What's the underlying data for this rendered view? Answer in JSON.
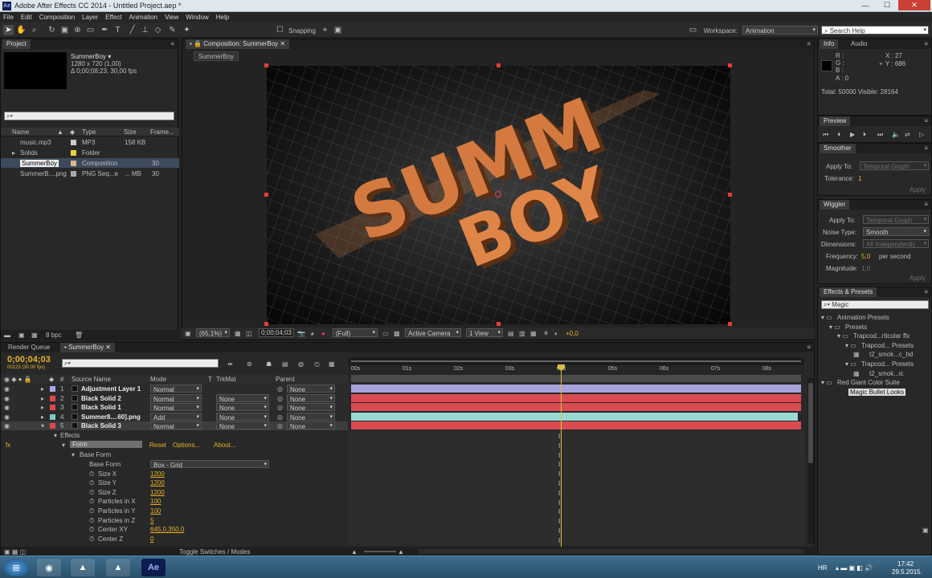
{
  "app": {
    "title": "Adobe After Effects CC 2014 - Untitled Project.aep *",
    "icon": "Ae"
  },
  "menu": [
    "File",
    "Edit",
    "Composition",
    "Layer",
    "Effect",
    "Animation",
    "View",
    "Window",
    "Help"
  ],
  "toolbar": {
    "snapping": "Snapping",
    "workspace_label": "Workspace:",
    "workspace": "Animation",
    "search_placeholder": "Search Help"
  },
  "project": {
    "tab": "Project",
    "comp_name": "SummerBoy ▾",
    "comp_dims": "1280 x 720 (1,00)",
    "comp_dur": "Δ 0;00;08;23, 30,00 fps",
    "search_placeholder": "",
    "columns": [
      "Name",
      "Type",
      "Size",
      "Frame..."
    ],
    "items": [
      {
        "name": "music.mp3",
        "type": "MP3",
        "size": "158 KB",
        "frame": "",
        "color": "#c9c9c9"
      },
      {
        "name": "Solids",
        "type": "Folder",
        "size": "",
        "frame": "",
        "color": "#e8d03a"
      },
      {
        "name": "SummerBoy",
        "type": "Composition",
        "size": "",
        "frame": "30",
        "color": "#d9b78a"
      },
      {
        "name": "SummerB....png",
        "type": "PNG Seq...e",
        "size": "... MB",
        "frame": "30",
        "color": "#a8a8a8"
      }
    ],
    "bpc": "8 bpc"
  },
  "composition": {
    "tab": "Composition: SummerBoy",
    "subtab": "SummerBoy",
    "zoom": "(65,1%)",
    "timecode": "0;00;04;03",
    "resolution": "(Full)",
    "camera": "Active Camera",
    "view": "1 View",
    "exposure": "+0,0",
    "artwork": [
      "SUMM",
      "BOY"
    ]
  },
  "info": {
    "tabs": [
      "Info",
      "Audio"
    ],
    "r": "R :",
    "g": "G :",
    "b": "B :",
    "a": "A : 0",
    "x": "X : 27",
    "y": "Y : 686",
    "total": "Total: 50000  Visible: 28164"
  },
  "preview": {
    "tab": "Preview"
  },
  "smoother": {
    "tab": "Smoother",
    "apply_to_label": "Apply To:",
    "apply_to": "Temporal Graph",
    "tolerance_label": "Tolerance:",
    "tolerance": "1",
    "apply": "Apply"
  },
  "wiggler": {
    "tab": "Wiggler",
    "apply_to_label": "Apply To:",
    "apply_to": "Temporal Graph",
    "noise_label": "Noise Type:",
    "noise": "Smooth",
    "dimensions_label": "Dimensions:",
    "dimensions": "All Independently",
    "frequency_label": "Frequency:",
    "frequency": "5,0",
    "frequency_unit": "per second",
    "magnitude_label": "Magnitude:",
    "magnitude": "1,0",
    "apply": "Apply"
  },
  "effects_presets": {
    "tab": "Effects & Presets",
    "search": "Magic",
    "tree": [
      {
        "label": "Animation Presets",
        "indent": 0,
        "type": "folder"
      },
      {
        "label": "Presets",
        "indent": 1,
        "type": "folder"
      },
      {
        "label": "Trapcod...rticular ffx",
        "indent": 2,
        "type": "folder"
      },
      {
        "label": "Trapcod... Presets",
        "indent": 3,
        "type": "folder"
      },
      {
        "label": "t2_smok...c_hd",
        "indent": 4,
        "type": "file"
      },
      {
        "label": "Trapcod... Presets",
        "indent": 3,
        "type": "folder"
      },
      {
        "label": "t2_smok...ic",
        "indent": 4,
        "type": "file"
      },
      {
        "label": "Red Giant Color Suite",
        "indent": 0,
        "type": "folder"
      },
      {
        "label": "Magic Bullet Looks",
        "indent": 1,
        "type": "fx"
      }
    ]
  },
  "timeline": {
    "tabs": [
      "Render Queue",
      "SummerBoy"
    ],
    "timecode": "0;00;04;03",
    "frames": "00123 (30.00 fps)",
    "headers": {
      "num": "#",
      "source": "Source Name",
      "mode": "Mode",
      "t": "T",
      "trkmat": "TrkMat",
      "parent": "Parent"
    },
    "layers": [
      {
        "num": "1",
        "name": "Adjustment Layer 1",
        "mode": "Normal",
        "trkmat": "",
        "parent": "None",
        "color": "#a9a9e8",
        "bar": "#a8a2da"
      },
      {
        "num": "2",
        "name": "Black Solid 2",
        "mode": "Normal",
        "trkmat": "None",
        "parent": "None",
        "color": "#e0484e",
        "bar": "#d94c52"
      },
      {
        "num": "3",
        "name": "Black Solid 1",
        "mode": "Normal",
        "trkmat": "None",
        "parent": "None",
        "color": "#e0484e",
        "bar": "#d94c52"
      },
      {
        "num": "4",
        "name": "Summer8....60].png",
        "mode": "Add",
        "trkmat": "None",
        "parent": "None",
        "color": "#7ec9c9",
        "bar": "#9ad8d2"
      },
      {
        "num": "5",
        "name": "Black Solid 3",
        "mode": "Normal",
        "trkmat": "None",
        "parent": "None",
        "color": "#e0484e",
        "bar": "#d94c52"
      }
    ],
    "effects_label": "Effects",
    "form": {
      "name": "Form",
      "reset": "Reset",
      "options": "Options...",
      "about": "About..."
    },
    "base_form_group": "Base Form",
    "properties": [
      {
        "name": "Base Form",
        "value": "Box - Grid",
        "dropdown": true
      },
      {
        "name": "Size X",
        "value": "1200"
      },
      {
        "name": "Size Y",
        "value": "1200"
      },
      {
        "name": "Size Z",
        "value": "1200"
      },
      {
        "name": "Particles in X",
        "value": "100"
      },
      {
        "name": "Particles in Y",
        "value": "100"
      },
      {
        "name": "Particles in Z",
        "value": "5"
      },
      {
        "name": "Center XY",
        "value": "645,0,350,0"
      },
      {
        "name": "Center Z",
        "value": "0"
      }
    ],
    "ruler": [
      "00s",
      "01s",
      "02s",
      "03s",
      "04s",
      "05s",
      "06s",
      "07s",
      "08s"
    ],
    "toggle": "Toggle Switches / Modes"
  },
  "taskbar": {
    "lang": "HR",
    "time": "17:42",
    "date": "29.5.2015."
  },
  "colors": {
    "accent": "#e8b327",
    "playhead": "#d9c04a"
  }
}
